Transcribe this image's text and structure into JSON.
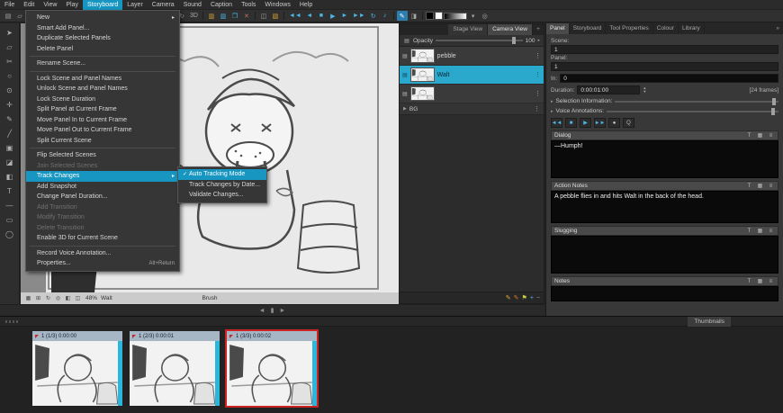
{
  "menubar": {
    "items": [
      "File",
      "Edit",
      "View",
      "Play",
      "Storyboard",
      "Layer",
      "Camera",
      "Sound",
      "Caption",
      "Tools",
      "Windows",
      "Help"
    ],
    "active": "Storyboard"
  },
  "toolbar": {
    "icons": [
      {
        "name": "new-icon",
        "glyph": "▤"
      },
      {
        "name": "open-icon",
        "glyph": "▱"
      },
      {
        "name": "save-icon",
        "glyph": "▣"
      },
      {
        "type": "sep"
      },
      {
        "name": "cut-icon",
        "glyph": "✂"
      },
      {
        "name": "copy-icon",
        "glyph": "❐"
      },
      {
        "name": "paste-icon",
        "glyph": "▩"
      },
      {
        "type": "sep"
      },
      {
        "name": "undo-icon",
        "glyph": "↶"
      },
      {
        "name": "redo-icon",
        "glyph": "↷"
      },
      {
        "type": "sep"
      },
      {
        "name": "select-tool-icon",
        "glyph": "➤"
      },
      {
        "name": "hand-tool-icon",
        "glyph": "✛"
      },
      {
        "name": "zoom-in-icon",
        "glyph": "⊕"
      },
      {
        "name": "zoom-out-icon",
        "glyph": "⊖"
      },
      {
        "type": "sep"
      },
      {
        "name": "grid-icon",
        "glyph": "▦"
      },
      {
        "name": "rotate-view-icon",
        "glyph": "↻"
      },
      {
        "name": "3d-toggle",
        "glyph": "3D",
        "wide": true
      },
      {
        "type": "sep"
      },
      {
        "name": "add-panel-icon",
        "glyph": "▥",
        "color": "#d9a62e"
      },
      {
        "name": "smart-add-panel-icon",
        "glyph": "▥",
        "color": "#4ab7e6"
      },
      {
        "name": "duplicate-panel-icon",
        "glyph": "❐",
        "color": "#4ab7e6"
      },
      {
        "name": "delete-panel-icon",
        "glyph": "✕",
        "color": "#c66a6a"
      },
      {
        "type": "sep"
      },
      {
        "name": "split-panel-icon",
        "glyph": "◫"
      },
      {
        "name": "new-scene-icon",
        "glyph": "▧",
        "color": "#d9a62e"
      },
      {
        "type": "sep"
      },
      {
        "name": "first-frame-button",
        "glyph": "◄◄",
        "color": "#4ab7e6",
        "wide": true
      },
      {
        "name": "prev-frame-button",
        "glyph": "◄",
        "color": "#4ab7e6"
      },
      {
        "name": "stop-button",
        "glyph": "■",
        "color": "#4ab7e6"
      },
      {
        "name": "play-button",
        "glyph": "▶",
        "color": "#4ab7e6"
      },
      {
        "name": "next-frame-button",
        "glyph": "►",
        "color": "#4ab7e6"
      },
      {
        "name": "last-frame-button",
        "glyph": "►►",
        "color": "#4ab7e6",
        "wide": true
      },
      {
        "name": "loop-button",
        "glyph": "↻",
        "color": "#4ab7e6"
      },
      {
        "name": "sound-toggle-icon",
        "glyph": "♪",
        "color": "#4ab7e6"
      },
      {
        "type": "sep"
      },
      {
        "name": "pen-mode-icon",
        "glyph": "✎",
        "active": true
      },
      {
        "name": "eraser-mode-icon",
        "glyph": "◨"
      },
      {
        "type": "sep"
      },
      {
        "name": "black-swatch",
        "type": "swatch",
        "color": "#000000"
      },
      {
        "name": "white-swatch",
        "type": "swatch",
        "color": "#ffffff"
      },
      {
        "name": "gradient-slider",
        "type": "gradient"
      },
      {
        "name": "brush-size-dropdown",
        "glyph": "▾"
      },
      {
        "name": "onion-skin-icon",
        "glyph": "◎"
      }
    ]
  },
  "left_toolbar": {
    "icons": [
      {
        "name": "select-tool-icon",
        "glyph": "➤"
      },
      {
        "name": "transform-tool-icon",
        "glyph": "▱"
      },
      {
        "name": "cutter-tool-icon",
        "glyph": "✂"
      },
      {
        "name": "contour-tool-icon",
        "glyph": "○"
      },
      {
        "name": "zoom-tool-icon",
        "glyph": "⊙"
      },
      {
        "name": "hand-tool-icon",
        "glyph": "✛"
      },
      {
        "name": "brush-tool-icon",
        "glyph": "✎"
      },
      {
        "name": "pencil-tool-icon",
        "glyph": "╱"
      },
      {
        "name": "stamp-tool-icon",
        "glyph": "▣"
      },
      {
        "name": "eraser-tool-icon",
        "glyph": "◪"
      },
      {
        "name": "paint-tool-icon",
        "glyph": "◧"
      },
      {
        "name": "text-tool-icon",
        "glyph": "T"
      },
      {
        "name": "line-tool-icon",
        "glyph": "—"
      },
      {
        "name": "rectangle-tool-icon",
        "glyph": "▭"
      },
      {
        "name": "ellipse-tool-icon",
        "glyph": "◯"
      }
    ]
  },
  "storyboard_menu": {
    "items": [
      {
        "label": "New",
        "submenu": true
      },
      {
        "label": "Smart Add Panel..."
      },
      {
        "label": "Duplicate Selected Panels"
      },
      {
        "label": "Delete Panel"
      },
      {
        "sep": true
      },
      {
        "label": "Rename Scene..."
      },
      {
        "sep": true
      },
      {
        "label": "Lock Scene and Panel Names"
      },
      {
        "label": "Unlock Scene and Panel Names"
      },
      {
        "label": "Lock Scene Duration"
      },
      {
        "label": "Split Panel at Current Frame"
      },
      {
        "label": "Move Panel In to Current Frame"
      },
      {
        "label": "Move Panel Out to Current Frame"
      },
      {
        "label": "Split Current Scene"
      },
      {
        "sep": true
      },
      {
        "label": "Flip Selected Scenes"
      },
      {
        "label": "Join Selected Scenes",
        "disabled": true
      },
      {
        "label": "Track Changes",
        "submenu": true,
        "highlight": true
      },
      {
        "label": "Add Snapshot"
      },
      {
        "label": "Change Panel Duration..."
      },
      {
        "label": "Add Transition",
        "disabled": true
      },
      {
        "label": "Modify Transition",
        "disabled": true
      },
      {
        "label": "Delete Transition",
        "disabled": true
      },
      {
        "label": "Enable 3D for Current Scene"
      },
      {
        "sep": true
      },
      {
        "label": "Record Voice Annotation..."
      },
      {
        "label": "Properties...",
        "shortcut": "Alt+Return"
      }
    ]
  },
  "track_changes_submenu": {
    "items": [
      {
        "label": "Auto Tracking Mode",
        "checked": true,
        "highlight": true
      },
      {
        "label": "Track Changes by Date..."
      },
      {
        "label": "Validate Changes..."
      }
    ]
  },
  "stage_panel": {
    "tabs": [
      {
        "label": "Stage View"
      },
      {
        "label": "Camera View",
        "active": true
      }
    ],
    "add_tab_glyph": "+",
    "opacity_label": "Opacity",
    "opacity_value": "100",
    "layers": [
      {
        "name": "pebble"
      },
      {
        "name": "Walt",
        "selected": true
      },
      {
        "name": ""
      }
    ],
    "bg_group_label": "BG",
    "footer_icons": [
      {
        "name": "edit-pencil-icon",
        "glyph": "✎",
        "color": "#e0b23a"
      },
      {
        "name": "annotation-pencil-icon",
        "glyph": "✎",
        "color": "#e07a2e"
      },
      {
        "name": "flag-icon",
        "glyph": "⚑",
        "color": "#c9cf3e"
      },
      {
        "name": "add-layer-icon",
        "glyph": "+",
        "color": "#4ab7e6"
      },
      {
        "name": "remove-layer-icon",
        "glyph": "−",
        "color": "#9a9a9a"
      }
    ]
  },
  "right_panel": {
    "tabs": [
      {
        "label": "Panel",
        "active": true
      },
      {
        "label": "Storyboard"
      },
      {
        "label": "Tool Properties"
      },
      {
        "label": "Colour"
      },
      {
        "label": "Library"
      }
    ],
    "chevron": "»",
    "scene_label": "Scene:",
    "scene_value": "1",
    "panel_label": "Panel:",
    "panel_value": "1",
    "in_label": "In:",
    "in_value": "0",
    "duration_label": "Duration:",
    "duration_value": "0:00:01:00",
    "frames_text": "[24 frames]",
    "selection_label": "Selection Information:",
    "voice_label": "Voice Annotations:",
    "voice_controls": [
      {
        "name": "rewind-button",
        "glyph": "◄◄",
        "color": "#4ab7e6"
      },
      {
        "name": "stop-button",
        "glyph": "■",
        "color": "#4ab7e6"
      },
      {
        "name": "play-button",
        "glyph": "▶",
        "color": "#4ab7e6"
      },
      {
        "name": "forward-button",
        "glyph": "►►",
        "color": "#4ab7e6"
      },
      {
        "name": "record-button",
        "glyph": "●",
        "color": "#d0d0d0"
      },
      {
        "name": "mute-button",
        "glyph": "Q",
        "color": "#b8b8b8"
      }
    ],
    "caption_icons": [
      {
        "name": "format-text-icon",
        "glyph": "T"
      },
      {
        "name": "insert-field-icon",
        "glyph": "▦"
      },
      {
        "name": "caption-menu-icon",
        "glyph": "≡"
      }
    ],
    "captions": [
      {
        "title": "Dialog",
        "text": "—Humph!"
      },
      {
        "title": "Action Notes",
        "text": "A pebble flies in and hits Walt in the back of the head."
      },
      {
        "title": "Slugging",
        "text": ""
      },
      {
        "title": "Notes",
        "text": ""
      }
    ]
  },
  "canvas_statusbar": {
    "icons": [
      {
        "name": "fit-view-icon",
        "glyph": "▦"
      },
      {
        "name": "grid-toggle-icon",
        "glyph": "⊞"
      },
      {
        "name": "rotate-ccw-icon",
        "glyph": "↻"
      },
      {
        "name": "reset-view-icon",
        "glyph": "◎"
      },
      {
        "name": "mirror-view-icon",
        "glyph": "◧"
      },
      {
        "name": "light-table-icon",
        "glyph": "◫"
      }
    ],
    "zoom": "48%",
    "layer": "Walt",
    "tool": "Brush"
  },
  "scroll_row": {
    "left_arrow": "◄",
    "thumb": "▮",
    "right_arrow": "►"
  },
  "thumbnails": {
    "tab_label": "Thumbnails",
    "items": [
      {
        "caption": "1 (1/3)  0:00:00"
      },
      {
        "caption": "1 (2/3)  0:00:01"
      },
      {
        "caption": "1 (3/3)  0:00:02",
        "selected": true
      }
    ]
  },
  "colors": {
    "accent": "#1796c1",
    "layer_selection": "#2aa9cd",
    "selected_thumb_border": "#cc2222",
    "panel_strip": "#29b8dc"
  }
}
